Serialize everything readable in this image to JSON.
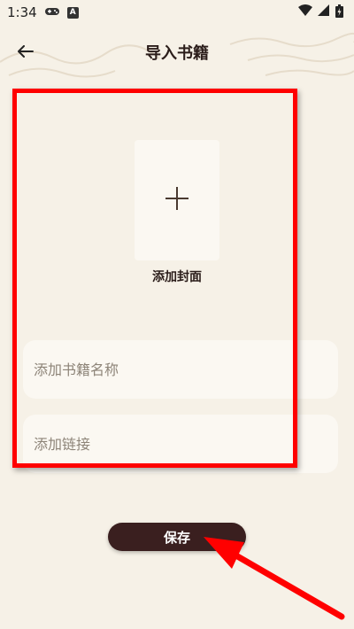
{
  "status_bar": {
    "time": "1:34",
    "a_badge": "A"
  },
  "header": {
    "title": "导入书籍"
  },
  "cover": {
    "label": "添加封面"
  },
  "form": {
    "name_placeholder": "添加书籍名称",
    "name_value": "",
    "link_placeholder": "添加链接",
    "link_value": ""
  },
  "actions": {
    "save_label": "保存"
  },
  "colors": {
    "background": "#f6f1e7",
    "field_bg": "#fbf8f2",
    "primary_dark": "#3a1f1f",
    "annotation_red": "#ff0000"
  }
}
